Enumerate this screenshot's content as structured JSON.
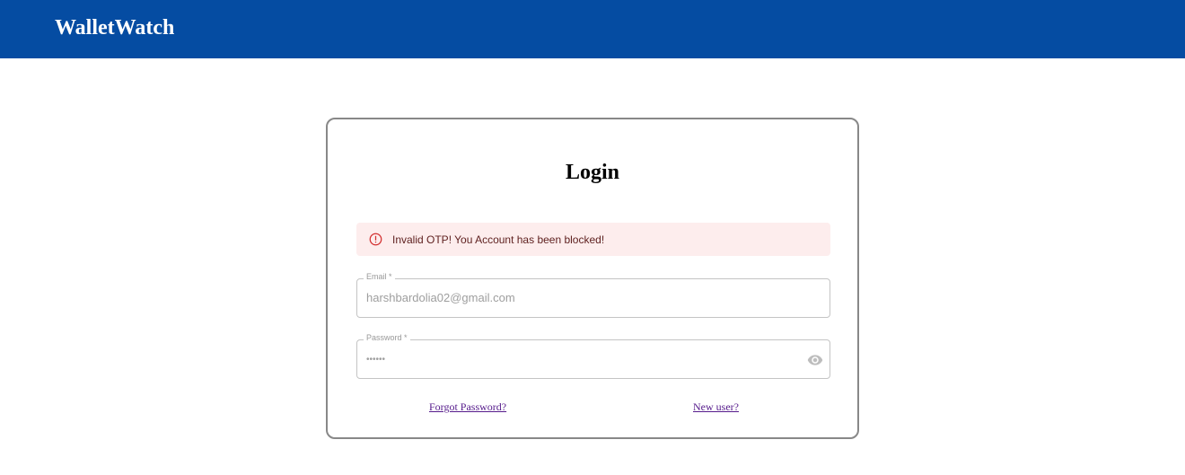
{
  "header": {
    "brand": "WalletWatch"
  },
  "login": {
    "title": "Login",
    "alert": {
      "message": "Invalid OTP! You Account has been blocked!",
      "icon": "error-outline-icon",
      "color": "#d32f2f"
    },
    "email": {
      "label": "Email *",
      "value": "harshbardolia02@gmail.com"
    },
    "password": {
      "label": "Password *",
      "value": "••••••",
      "toggle_icon": "eye-icon"
    },
    "forgot_link": "Forgot Password?",
    "new_user_link": "New user?"
  }
}
